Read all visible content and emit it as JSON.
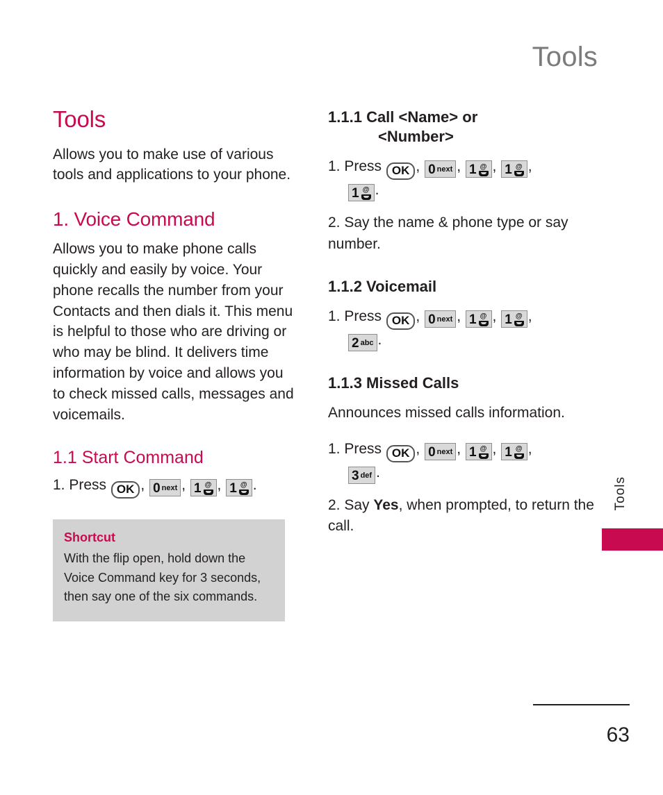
{
  "running_head": "Tools",
  "left_column": {
    "title": "Tools",
    "intro": "Allows you to make use of various tools and applications to your phone.",
    "section_title": "1. Voice Command",
    "section_body": "Allows you to make phone calls quickly and easily by voice. Your phone recalls the number from your Contacts and then dials it. This menu is helpful to those who are driving or who may be blind. It delivers time information by voice and allows you to check missed calls, messages and voicemails.",
    "subsection_title": "1.1 Start Command",
    "step1_prefix": "1. Press",
    "step1_suffix": ".",
    "shortcut": {
      "label": "Shortcut",
      "text": "With the flip open, hold down the Voice Command key for 3 seconds, then say one of the six commands."
    }
  },
  "right_column": {
    "sub1": {
      "number": "1.1.1",
      "title_line1": "Call <Name> or",
      "title_line2": "<Number>",
      "step1_prefix": "1. Press",
      "step1_suffix": ".",
      "step2": "2. Say the name & phone type or say number."
    },
    "sub2": {
      "heading": "1.1.2 Voicemail",
      "step1_prefix": "1. Press",
      "step1_suffix": "."
    },
    "sub3": {
      "heading": "1.1.3 Missed Calls",
      "body": "Announces missed calls information.",
      "step1_prefix": "1. Press",
      "step1_suffix": ".",
      "step2_pre": "2. Say ",
      "step2_bold": "Yes",
      "step2_post": ", when prompted, to return the call."
    }
  },
  "keys": {
    "ok": "OK",
    "zero_digit": "0",
    "zero_sub": "next",
    "one_digit": "1",
    "one_sub": "@",
    "two_digit": "2",
    "two_sub": "abc",
    "three_digit": "3",
    "three_sub": "def"
  },
  "thumb_tab": {
    "label": "Tools"
  },
  "footer": {
    "page_number": "63"
  },
  "colors": {
    "accent_pink": "#c80a50",
    "running_head_gray": "#7b7b7b",
    "shortcut_bg": "#d2d2d2",
    "key_bg": "#d9d9d9",
    "text": "#231f20"
  }
}
